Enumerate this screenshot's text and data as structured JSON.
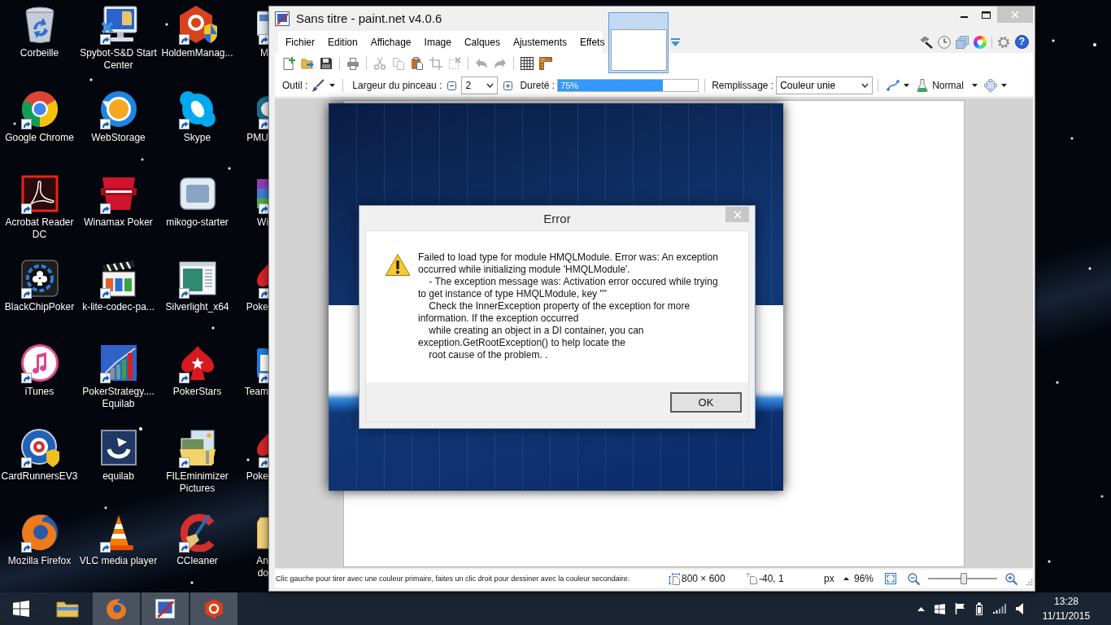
{
  "desktop_icons": [
    {
      "label": "Corbeille",
      "shortcut": false
    },
    {
      "label": "Spybot-S&D Start Center",
      "shortcut": true
    },
    {
      "label": "HoldemManag...",
      "shortcut": true
    },
    {
      "label": "M",
      "shortcut": true
    },
    {
      "label": "Google Chrome",
      "shortcut": true
    },
    {
      "label": "WebStorage",
      "shortcut": true
    },
    {
      "label": "Skype",
      "shortcut": true
    },
    {
      "label": "PMU",
      "shortcut": true
    },
    {
      "label": "Acrobat Reader DC",
      "shortcut": true
    },
    {
      "label": "Winamax Poker",
      "shortcut": true
    },
    {
      "label": "mikogo-starter",
      "shortcut": false
    },
    {
      "label": "Wi",
      "shortcut": true
    },
    {
      "label": "BlackChipPoker",
      "shortcut": true
    },
    {
      "label": "k-lite-codec-pa...",
      "shortcut": true
    },
    {
      "label": "Silverlight_x64",
      "shortcut": true
    },
    {
      "label": "Poke",
      "shortcut": true
    },
    {
      "label": "iTunes",
      "shortcut": true
    },
    {
      "label": "PokerStrategy.... Equilab",
      "shortcut": true
    },
    {
      "label": "PokerStars",
      "shortcut": true
    },
    {
      "label": "Team",
      "shortcut": true
    },
    {
      "label": "CardRunnersEV3",
      "shortcut": true
    },
    {
      "label": "equilab",
      "shortcut": false
    },
    {
      "label": "FILEminimizer Pictures",
      "shortcut": true
    },
    {
      "label": "Poke",
      "shortcut": true
    },
    {
      "label": "Mozilla Firefox",
      "shortcut": true
    },
    {
      "label": "VLC media player",
      "shortcut": true
    },
    {
      "label": "CCleaner",
      "shortcut": true
    },
    {
      "label": "An\ndo",
      "shortcut": false
    }
  ],
  "paint_window": {
    "title": "Sans titre - paint.net v4.0.6",
    "menu": [
      "Fichier",
      "Edition",
      "Affichage",
      "Image",
      "Calques",
      "Ajustements",
      "Effets"
    ],
    "image_tabs": [
      {
        "selected": true
      }
    ],
    "help": "?",
    "toolbar_groups": [
      [
        {
          "disabled": false
        },
        {
          "disabled": false
        },
        {
          "disabled": false
        }
      ],
      [
        {
          "disabled": false
        }
      ],
      [
        {
          "disabled": true
        },
        {
          "disabled": true
        },
        {
          "disabled": false
        },
        {
          "disabled": true
        },
        {
          "disabled": true
        }
      ],
      [
        {
          "disabled": true
        },
        {
          "disabled": true
        }
      ],
      [
        {
          "disabled": false
        },
        {
          "disabled": false
        }
      ]
    ],
    "tool": {
      "label": "Outil :"
    },
    "brush_width": {
      "label": "Largeur du pinceau :",
      "value": "2"
    },
    "hardness": {
      "label": "Dureté :",
      "value": "75%",
      "level": 0.75
    },
    "fill": {
      "label": "Remplissage :",
      "value": "Couleur unie"
    },
    "blend_mode": "Normal",
    "status_bar": {
      "hint": "Clic gauche pour tirer avec une couleur primaire, faites un clic droit pour dessiner avec la couleur secondaire.",
      "image_size": "800 × 600",
      "cursor_position": "-40, 1",
      "units": "px",
      "zoom": "96%",
      "zoom_slider": {
        "level": 0.5
      }
    }
  },
  "error_dialog": {
    "title": "Error",
    "message": "Failed to load type for module HMQLModule. Error was: An exception occurred while initializing module 'HMQLModule'.\n    - The exception message was: Activation error occured while trying to get instance of type HMQLModule, key \"\"\n    Check the InnerException property of the exception for more information. If the exception occurred\n    while creating an object in a DI container, you can exception.GetRootException() to help locate the\n    root cause of the problem. .",
    "buttons": [
      "OK"
    ]
  },
  "taskbar": {
    "apps": [
      {
        "running": false
      },
      {
        "running": true
      },
      {
        "running": true
      },
      {
        "running": true
      }
    ],
    "time": "13:28",
    "date": "11/11/2015"
  }
}
